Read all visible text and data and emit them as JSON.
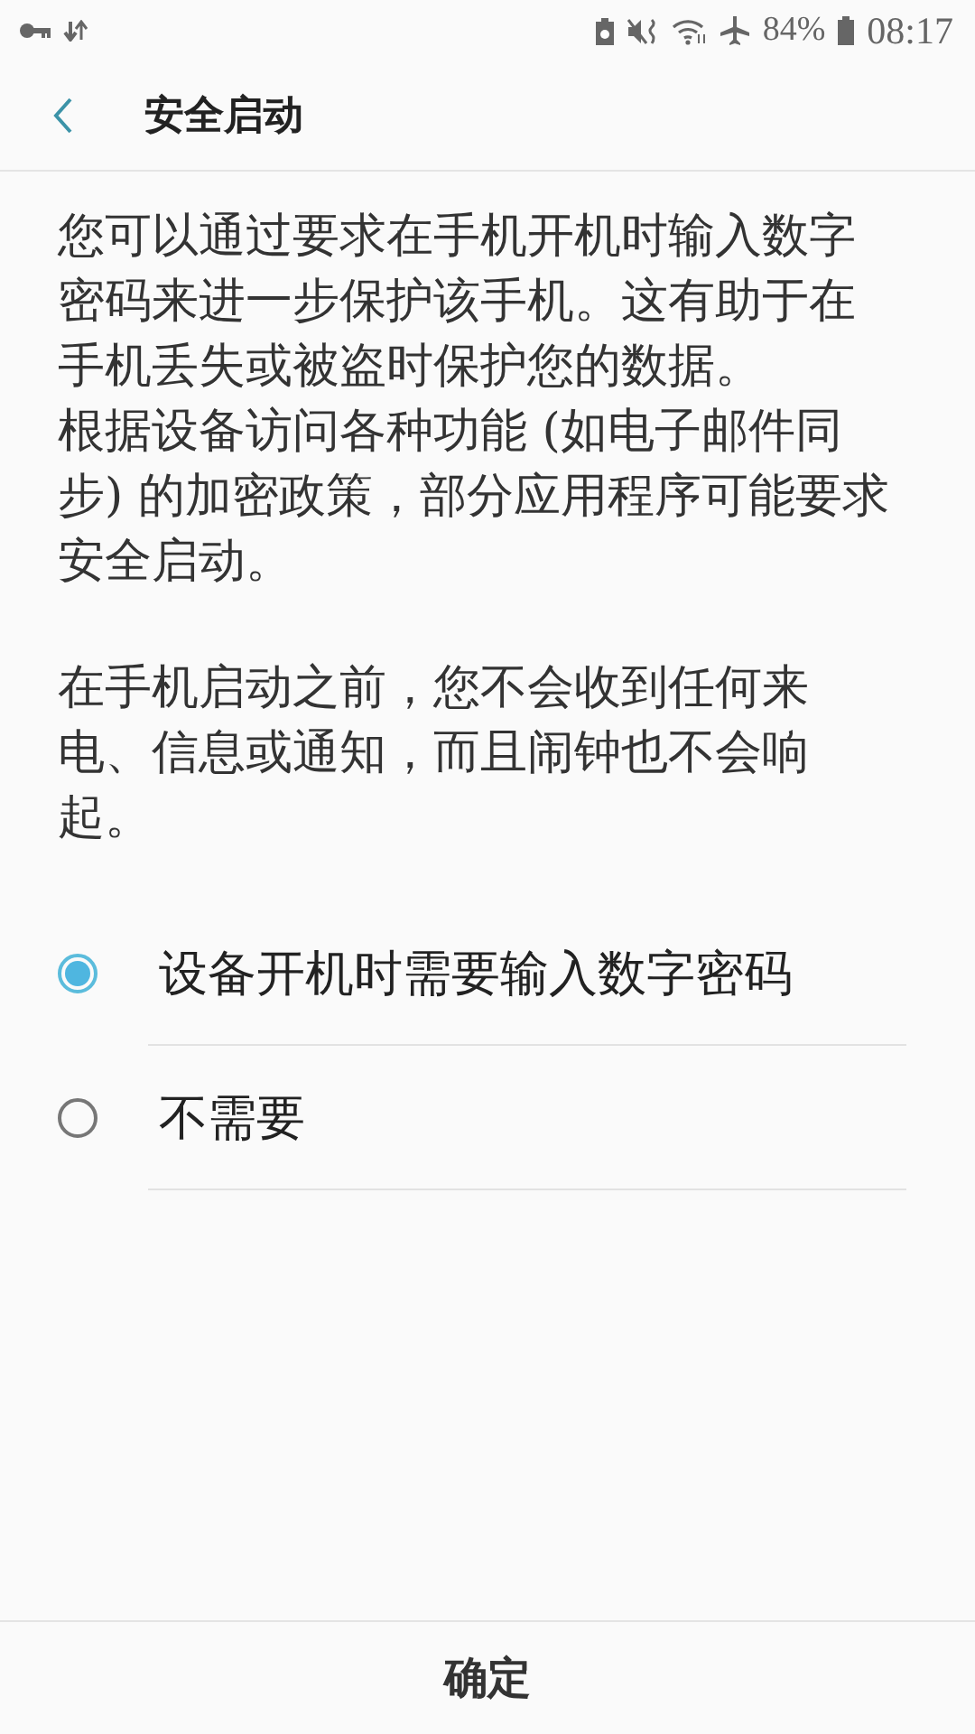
{
  "status_bar": {
    "battery_percent": "84%",
    "time": "08:17"
  },
  "header": {
    "title": "安全启动"
  },
  "description": [
    [
      "您可以通过要求在手机开机时输入数字密码来进一步保护该手机。这有助于在手机丢失或被盗时保护您的数据。",
      "根据设备访问各种功能 (如电子邮件同步) 的加密政策，部分应用程序可能要求安全启动。"
    ],
    [
      "在手机启动之前，您不会收到任何来电、信息或通知，而且闹钟也不会响起。"
    ]
  ],
  "options": [
    {
      "label": "设备开机时需要输入数字密码",
      "selected": true
    },
    {
      "label": "不需要",
      "selected": false
    }
  ],
  "confirm_button": "确定"
}
